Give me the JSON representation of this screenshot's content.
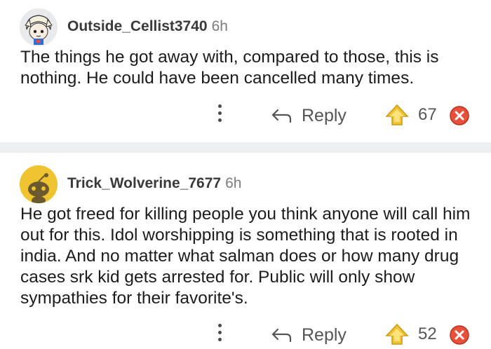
{
  "comments": [
    {
      "username": "Outside_Cellist3740",
      "time": "6h",
      "text": "The things he got away with, compared to those, this is nothing. He could have been cancelled many times.",
      "reply_label": "Reply",
      "score": "67"
    },
    {
      "username": "Trick_Wolverine_7677",
      "time": "6h",
      "text": "He got freed for killing people you think anyone will call him out for this. Idol worshipping is something that is rooted in india. And no matter what salman does or how many drug cases srk kid gets arrested for. Public will only show sympathies for their favorite's.",
      "reply_label": "Reply",
      "score": "52"
    }
  ],
  "colors": {
    "upvote_gold": "#f1c232",
    "downvote_red": "#e8503c",
    "divider": "#eeeff1",
    "avatar2_bg": "#f0c330"
  },
  "icons": [
    "avatar-anime",
    "avatar-snoo",
    "more-icon",
    "reply-arrow-icon",
    "upvote-award-icon",
    "downvote-icon"
  ]
}
